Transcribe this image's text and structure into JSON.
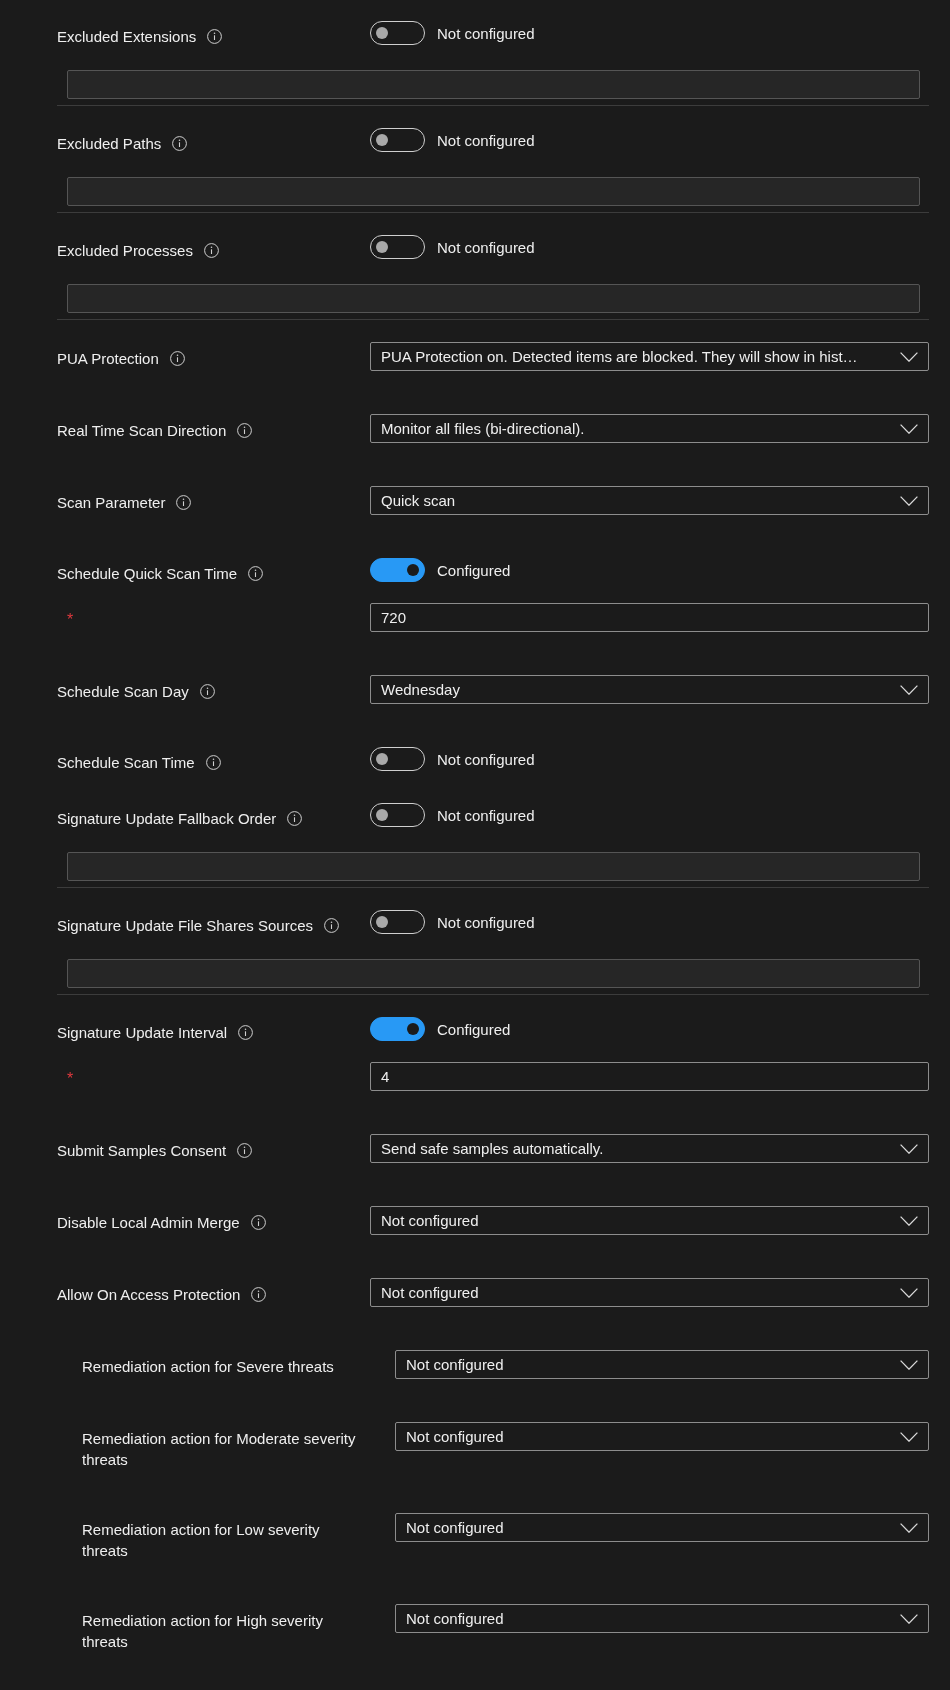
{
  "settings": [
    {
      "kind": "toggle-list",
      "label": "Excluded Extensions",
      "configured": false,
      "status": "Not configured"
    },
    {
      "kind": "toggle-list",
      "label": "Excluded Paths",
      "configured": false,
      "status": "Not configured"
    },
    {
      "kind": "toggle-list",
      "label": "Excluded Processes",
      "configured": false,
      "status": "Not configured"
    },
    {
      "kind": "dropdown",
      "label": "PUA Protection",
      "value": "PUA Protection on. Detected items are blocked. They will show in hist…"
    },
    {
      "kind": "dropdown",
      "label": "Real Time Scan Direction",
      "value": "Monitor all files (bi-directional)."
    },
    {
      "kind": "dropdown",
      "label": "Scan Parameter",
      "value": "Quick scan"
    },
    {
      "kind": "toggle-value",
      "label": "Schedule Quick Scan Time",
      "configured": true,
      "status": "Configured",
      "required_mark": "*",
      "value": "720"
    },
    {
      "kind": "dropdown",
      "label": "Schedule Scan Day",
      "value": "Wednesday"
    },
    {
      "kind": "toggle",
      "label": "Schedule Scan Time",
      "configured": false,
      "status": "Not configured"
    },
    {
      "kind": "toggle-list",
      "label": "Signature Update Fallback Order",
      "configured": false,
      "status": "Not configured"
    },
    {
      "kind": "toggle-list",
      "label": "Signature Update File Shares Sources",
      "configured": false,
      "status": "Not configured"
    },
    {
      "kind": "toggle-value",
      "label": "Signature Update Interval",
      "configured": true,
      "status": "Configured",
      "required_mark": "*",
      "value": "4"
    },
    {
      "kind": "dropdown",
      "label": "Submit Samples Consent",
      "value": "Send safe samples automatically."
    },
    {
      "kind": "dropdown",
      "label": "Disable Local Admin Merge",
      "value": "Not configured"
    },
    {
      "kind": "dropdown",
      "label": "Allow On Access Protection",
      "value": "Not configured",
      "children": [
        {
          "kind": "dropdown",
          "label": "Remediation action for Severe threats",
          "value": "Not configured"
        },
        {
          "kind": "dropdown",
          "label": "Remediation action for Moderate severity threats",
          "value": "Not configured"
        },
        {
          "kind": "dropdown",
          "label": "Remediation action for Low severity threats",
          "value": "Not configured"
        },
        {
          "kind": "dropdown",
          "label": "Remediation action for High severity threats",
          "value": "Not configured"
        }
      ]
    }
  ]
}
